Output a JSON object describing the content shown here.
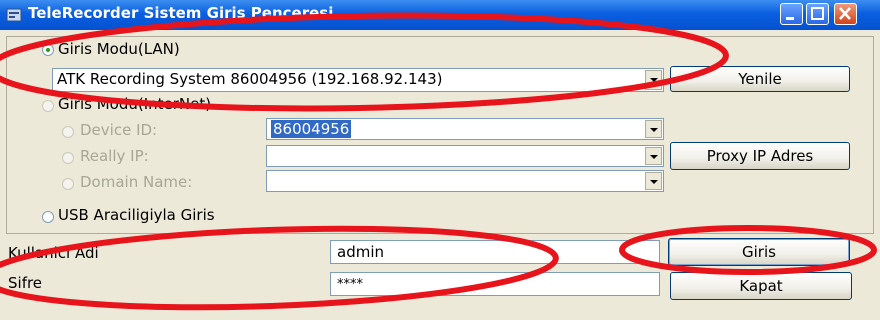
{
  "window": {
    "title": "TeleRecorder Sistem Giris Penceresi"
  },
  "lan": {
    "label": "Giris Modu(LAN)",
    "selected": true,
    "device": "ATK Recording System 86004956 (192.168.92.143)",
    "refresh_label": "Yenile"
  },
  "internet": {
    "label": "Giris Modu(InterNet)",
    "selected": false,
    "device_id_label": "Device ID:",
    "device_id_value": "86004956",
    "really_ip_label": "Really IP:",
    "really_ip_value": "",
    "domain_label": "Domain Name:",
    "domain_value": "",
    "proxy_label": "Proxy IP Adres"
  },
  "usb": {
    "label": "USB Araciligiyla Giris",
    "selected": false
  },
  "login": {
    "username_label": "Kullanici Adi",
    "username_value": "admin",
    "password_label": "Sifre",
    "password_value": "****",
    "login_button": "Giris",
    "close_button": "Kapat"
  },
  "colors": {
    "titlebar": "#0a5fe0",
    "annotation": "#e8141b",
    "selection": "#316ac5"
  }
}
